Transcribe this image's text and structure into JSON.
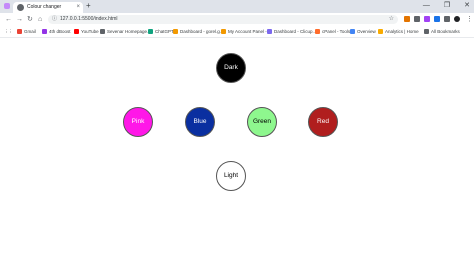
{
  "browser": {
    "tab_title": "Colour changer",
    "tab_close": "×",
    "new_tab": "+",
    "window_controls": [
      "—",
      "❐",
      "✕"
    ],
    "url": "127.0.0.1:5500/index.html",
    "nav": {
      "back": "←",
      "forward": "→",
      "reload": "↻",
      "home": "⌂"
    },
    "bookmarks": [
      {
        "label": "Gmail",
        "color": "#ea4335"
      },
      {
        "label": "4th dBoost",
        "color": "#9334e6"
      },
      {
        "label": "YouTube",
        "color": "#ff0000"
      },
      {
        "label": "Sevenar Homepage...",
        "color": "#5f6368"
      },
      {
        "label": "ChatGPT",
        "color": "#10a37f"
      },
      {
        "label": "Dashboard - gorel.g...",
        "color": "#f29900"
      },
      {
        "label": "My Account Panel -...",
        "color": "#f29900"
      },
      {
        "label": "Dashboard - Clicup...",
        "color": "#7b68ee"
      },
      {
        "label": "cPanel - Tools",
        "color": "#ff6c2c"
      },
      {
        "label": "Overview",
        "color": "#4285f4"
      },
      {
        "label": "Analytics | Home",
        "color": "#f9ab00"
      }
    ],
    "all_bookmarks": "All Bookmarks"
  },
  "buttons": {
    "dark": {
      "label": "Dark",
      "bg": "#000000",
      "fg": "#ffffff"
    },
    "pink": {
      "label": "Pink",
      "bg": "#ff17e8",
      "fg": "#ffffff"
    },
    "blue": {
      "label": "Blue",
      "bg": "#0a2fa0",
      "fg": "#ffffff"
    },
    "green": {
      "label": "Green",
      "bg": "#8ef78e",
      "fg": "#000000"
    },
    "red": {
      "label": "Red",
      "bg": "#b01e1e",
      "fg": "#ffffff"
    },
    "light": {
      "label": "Light",
      "bg": "#ffffff",
      "fg": "#000000"
    }
  }
}
